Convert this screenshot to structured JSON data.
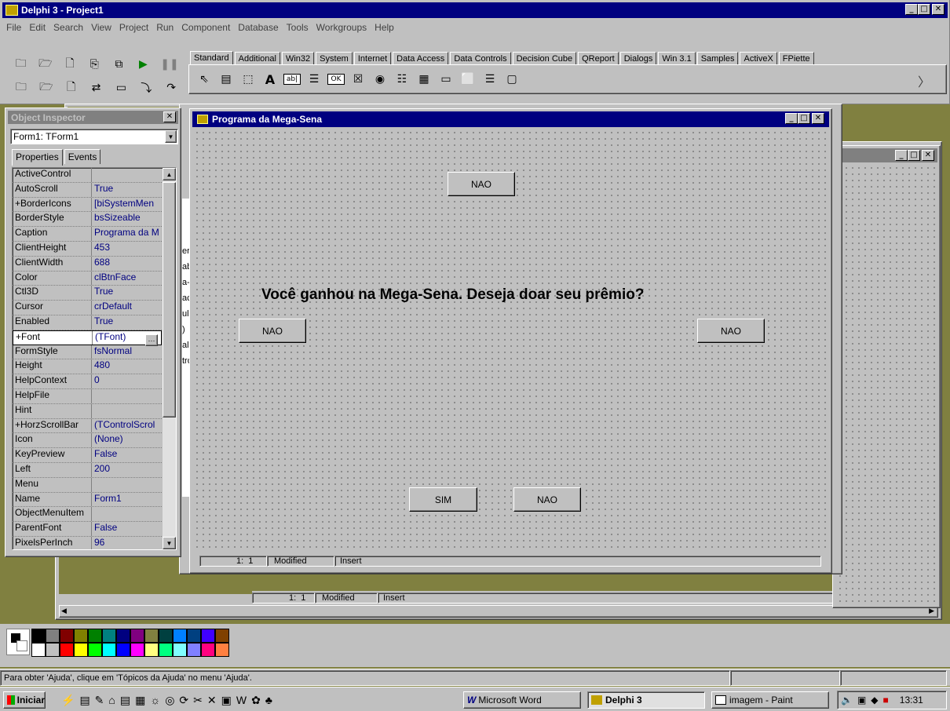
{
  "app": {
    "title": "Delphi 3 - Project1",
    "menu": [
      "File",
      "Edit",
      "Search",
      "View",
      "Project",
      "Run",
      "Component",
      "Database",
      "Tools",
      "Workgroups",
      "Help"
    ]
  },
  "palette": {
    "tabs": [
      "Standard",
      "Additional",
      "Win32",
      "System",
      "Internet",
      "Data Access",
      "Data Controls",
      "Decision Cube",
      "QReport",
      "Dialogs",
      "Win 3.1",
      "Samples",
      "ActiveX",
      "FPiette"
    ],
    "active_tab": "Standard",
    "components": [
      "arrow-cursor",
      "main-menu",
      "popup-menu",
      "label",
      "edit",
      "memo",
      "button",
      "checkbox",
      "radiobutton",
      "listbox",
      "combobox",
      "scrollbar",
      "groupbox",
      "radiogroup",
      "panel"
    ]
  },
  "inspector": {
    "title": "Object Inspector",
    "object": "Form1: TForm1",
    "tabs": [
      "Properties",
      "Events"
    ],
    "rows": [
      {
        "k": "ActiveControl",
        "v": ""
      },
      {
        "k": "AutoScroll",
        "v": "True"
      },
      {
        "k": "+BorderIcons",
        "v": "[biSystemMen"
      },
      {
        "k": "BorderStyle",
        "v": "bsSizeable"
      },
      {
        "k": "Caption",
        "v": "Programa da M"
      },
      {
        "k": "ClientHeight",
        "v": "453"
      },
      {
        "k": "ClientWidth",
        "v": "688"
      },
      {
        "k": "Color",
        "v": "clBtnFace"
      },
      {
        "k": "Ctl3D",
        "v": "True"
      },
      {
        "k": "Cursor",
        "v": "crDefault"
      },
      {
        "k": "Enabled",
        "v": "True"
      },
      {
        "k": "+Font",
        "v": "(TFont)"
      },
      {
        "k": "FormStyle",
        "v": "fsNormal"
      },
      {
        "k": "Height",
        "v": "480"
      },
      {
        "k": "HelpContext",
        "v": "0"
      },
      {
        "k": "HelpFile",
        "v": ""
      },
      {
        "k": "Hint",
        "v": ""
      },
      {
        "k": "+HorzScrollBar",
        "v": "(TControlScrol"
      },
      {
        "k": "Icon",
        "v": "(None)"
      },
      {
        "k": "KeyPreview",
        "v": "False"
      },
      {
        "k": "Left",
        "v": "200"
      },
      {
        "k": "Menu",
        "v": ""
      },
      {
        "k": "Name",
        "v": "Form1"
      },
      {
        "k": "ObjectMenuItem",
        "v": ""
      },
      {
        "k": "ParentFont",
        "v": "False"
      },
      {
        "k": "PixelsPerInch",
        "v": "96"
      }
    ]
  },
  "back_inspector": {
    "rows": [
      {
        "k": "ObjectMenuItem",
        "v": ""
      },
      {
        "k": "ParentFont",
        "v": "False"
      },
      {
        "k": "PixelsPerInch",
        "v": "96"
      }
    ]
  },
  "form": {
    "title": "Programa da Mega-Sena",
    "question": "Você ganhou na Mega-Sena. Deseja doar seu prêmio?",
    "btn_top": "NAO",
    "btn_left": "NAO",
    "btn_right": "NAO",
    "btn_sim": "SIM",
    "btn_bottom_nao": "NAO"
  },
  "editor": {
    "position": "1:  1",
    "state": "Modified",
    "mode": "Insert"
  },
  "back_editor": {
    "position": "1:  1",
    "state": "Modified",
    "mode": "Insert"
  },
  "side_fragments": [
    "er",
    "ab",
    "a-S",
    "ac",
    "ul",
    ")",
    "al",
    "tro"
  ],
  "status": {
    "text": "Para obter 'Ajuda', clique em 'Tópicos da Ajuda' no menu 'Ajuda'."
  },
  "colors": {
    "paint_palette_top": [
      "#000000",
      "#808080",
      "#800000",
      "#808000",
      "#008000",
      "#008080",
      "#000080",
      "#800080",
      "#808040",
      "#004040",
      "#0080ff",
      "#004080",
      "#4000ff",
      "#804000"
    ],
    "paint_palette_bottom": [
      "#ffffff",
      "#c0c0c0",
      "#ff0000",
      "#ffff00",
      "#00ff00",
      "#00ffff",
      "#0000ff",
      "#ff00ff",
      "#ffff80",
      "#00ff80",
      "#80ffff",
      "#8080ff",
      "#ff0080",
      "#ff8040"
    ]
  },
  "taskbar": {
    "start": "Iniciar",
    "tasks": [
      "Microsoft Word",
      "Delphi 3",
      "imagem - Paint"
    ],
    "active_task": "Delphi 3",
    "clock": "13:31"
  }
}
